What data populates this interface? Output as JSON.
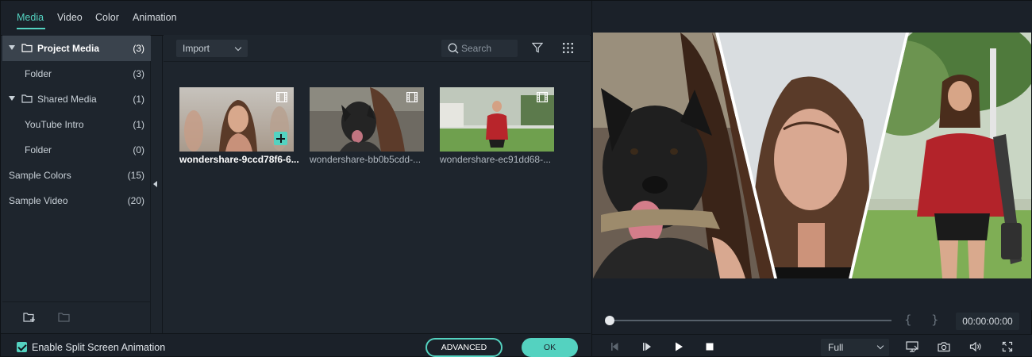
{
  "tabs": [
    {
      "label": "Media",
      "active": true
    },
    {
      "label": "Video",
      "active": false
    },
    {
      "label": "Color",
      "active": false
    },
    {
      "label": "Animation",
      "active": false
    }
  ],
  "sidebar": {
    "items": [
      {
        "label": "Project Media",
        "count": "(3)",
        "selected": true,
        "expandable": true,
        "folder": true
      },
      {
        "label": "Folder",
        "count": "(3)",
        "selected": false
      },
      {
        "label": "Shared Media",
        "count": "(1)",
        "selected": false,
        "expandable": true,
        "folder": true
      },
      {
        "label": "YouTube Intro",
        "count": "(1)",
        "selected": false
      },
      {
        "label": "Folder",
        "count": "(0)",
        "selected": false
      },
      {
        "label": "Sample Colors",
        "count": "(15)",
        "selected": false
      },
      {
        "label": "Sample Video",
        "count": "(20)",
        "selected": false
      }
    ],
    "new_folder_icon": "new-folder-icon",
    "folder_icon": "folder-outline-icon"
  },
  "toolbar": {
    "import_label": "Import",
    "search_placeholder": "Search",
    "filter_icon": "filter-icon",
    "grid_icon": "grid-view-icon"
  },
  "media": [
    {
      "name": "wondershare-9ccd78f6-6...",
      "selected": true,
      "scene": "woman-beach"
    },
    {
      "name": "wondershare-bb0b5cdd-...",
      "selected": false,
      "scene": "dog"
    },
    {
      "name": "wondershare-ec91dd68-...",
      "selected": false,
      "scene": "woman-red"
    }
  ],
  "bottom": {
    "checkbox_label": "Enable Split Screen Animation",
    "checked": true,
    "advanced_label": "ADVANCED",
    "ok_label": "OK"
  },
  "preview": {
    "mark_in": "{",
    "mark_out": "}",
    "timecode": "00:00:00:00",
    "progress": 0,
    "zoom": "Full"
  },
  "colors": {
    "accent": "#54d2c0",
    "panel": "#1e252d",
    "selected_row": "#3a434d"
  }
}
